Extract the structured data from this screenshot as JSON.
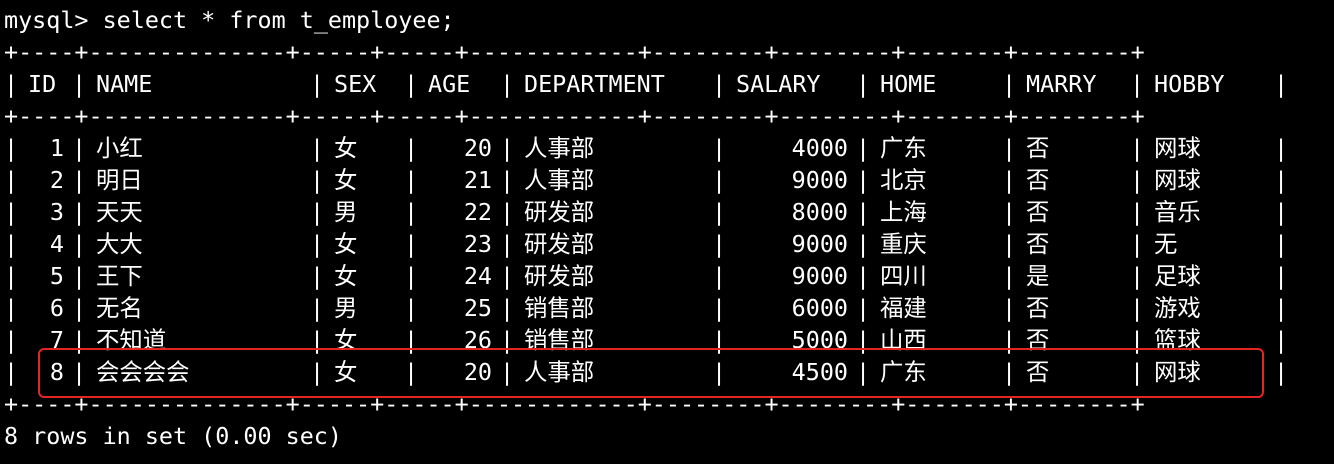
{
  "terminal": {
    "prompt": "mysql> ",
    "command": "select * from t_employee;",
    "separator": "+----+--------------+-----+-----+------------+--------+--------+-------+--------+",
    "columns": [
      "ID",
      "NAME",
      "SEX",
      "AGE",
      "DEPARTMENT",
      "SALARY",
      "HOME",
      "MARRY",
      "HOBBY"
    ],
    "rows": [
      {
        "id": "1",
        "name": "小红",
        "sex": "女",
        "age": "20",
        "department": "人事部",
        "salary": "4000",
        "home": "广东",
        "marry": "否",
        "hobby": "网球"
      },
      {
        "id": "2",
        "name": "明日",
        "sex": "女",
        "age": "21",
        "department": "人事部",
        "salary": "9000",
        "home": "北京",
        "marry": "否",
        "hobby": "网球"
      },
      {
        "id": "3",
        "name": "天天",
        "sex": "男",
        "age": "22",
        "department": "研发部",
        "salary": "8000",
        "home": "上海",
        "marry": "否",
        "hobby": "音乐"
      },
      {
        "id": "4",
        "name": "大大",
        "sex": "女",
        "age": "23",
        "department": "研发部",
        "salary": "9000",
        "home": "重庆",
        "marry": "否",
        "hobby": "无"
      },
      {
        "id": "5",
        "name": "王下",
        "sex": "女",
        "age": "24",
        "department": "研发部",
        "salary": "9000",
        "home": "四川",
        "marry": "是",
        "hobby": "足球"
      },
      {
        "id": "6",
        "name": "无名",
        "sex": "男",
        "age": "25",
        "department": "销售部",
        "salary": "6000",
        "home": "福建",
        "marry": "否",
        "hobby": "游戏"
      },
      {
        "id": "7",
        "name": "不知道",
        "sex": "女",
        "age": "26",
        "department": "销售部",
        "salary": "5000",
        "home": "山西",
        "marry": "否",
        "hobby": "篮球"
      },
      {
        "id": "8",
        "name": "会会会会",
        "sex": "女",
        "age": "20",
        "department": "人事部",
        "salary": "4500",
        "home": "广东",
        "marry": "否",
        "hobby": "网球"
      }
    ],
    "footer": "8 rows in set (0.00 sec)",
    "highlight_color": "#e32620",
    "text_color": "#ffffff",
    "background_color": "#000000"
  }
}
